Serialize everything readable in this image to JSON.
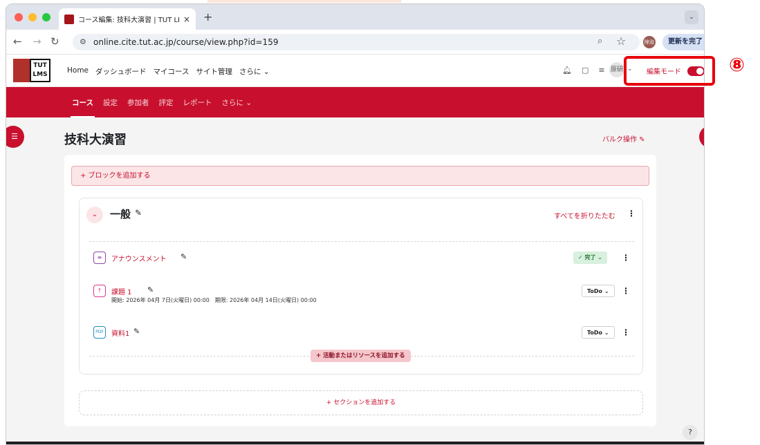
{
  "browser": {
    "tab_title": "コース編集: 技科大演習 | TUT LI",
    "tab_close": "×",
    "new_tab": "+",
    "menu_icon": "⌄",
    "url": "online.cite.tut.ac.jp/course/view.php?id=159",
    "profile_initials": "除治",
    "update_button": "更新を完了 ⋮"
  },
  "header": {
    "logo_line1": "TUT",
    "logo_line2": "LMS",
    "nav": [
      "Home",
      "ダッシュボード",
      "マイコース",
      "サイト管理",
      "さらに ⌄"
    ],
    "user_short": "原研",
    "user_caret": "⌄",
    "edit_mode_label": "編集モード"
  },
  "secondary_nav": {
    "items": [
      "コース",
      "設定",
      "参加者",
      "評定",
      "レポート",
      "さらに ⌄"
    ]
  },
  "page": {
    "title": "技科大演習",
    "bulk_edit": "バルク操作 ✎",
    "add_block": "+ ブロックを追加する",
    "section": {
      "title": "一般",
      "collapse_all": "すべてを折りたたむ",
      "activities": [
        {
          "name": "アナウンスメント",
          "icon": "forum-icon",
          "icon_color": "#8e44ad",
          "status": "✓ 完了 ⌄",
          "dates": ""
        },
        {
          "name": "課題 1",
          "icon": "assignment-icon",
          "icon_color": "#e0338c",
          "status": "ToDo ⌄",
          "dates": "開始: 2026年 04月 7日(火曜日) 00:00　期限: 2026年 04月 14日(火曜日) 00:00"
        },
        {
          "name": "資料1",
          "icon": "pdf-file-icon",
          "icon_color": "#1e8fbf",
          "status": "ToDo ⌄",
          "dates": ""
        }
      ],
      "add_activity": "+ 活動またはリソースを追加する"
    },
    "add_section": "+ セクションを追加する",
    "help": "?"
  },
  "annotation": {
    "marker": "⑧",
    "color": "#e8000b"
  },
  "colors": {
    "brand_red": "#c8102e"
  }
}
